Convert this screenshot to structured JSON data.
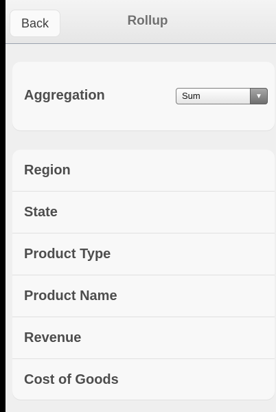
{
  "navbar": {
    "back_label": "Back",
    "title": "Rollup"
  },
  "aggregation": {
    "label": "Aggregation",
    "selected": "Sum"
  },
  "fields": [
    {
      "label": "Region"
    },
    {
      "label": "State"
    },
    {
      "label": "Product Type"
    },
    {
      "label": "Product Name"
    },
    {
      "label": "Revenue"
    },
    {
      "label": "Cost of Goods"
    }
  ],
  "colors": {
    "background": "#efefef",
    "card": "#f8f8f8",
    "label_text": "#4d4d4d",
    "title_text": "#707070",
    "frame": "#000000"
  },
  "icons": {
    "select_arrow": "triangle-down-icon"
  }
}
